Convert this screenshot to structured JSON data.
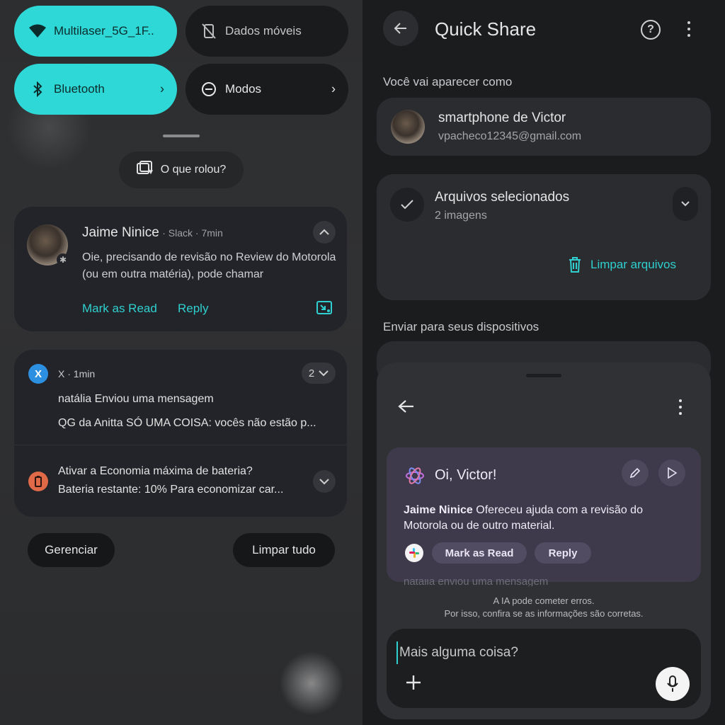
{
  "left": {
    "tiles": {
      "wifi": "Multilaser_5G_1F..",
      "mobile_data": "Dados móveis",
      "bluetooth": "Bluetooth",
      "modes": "Modos"
    },
    "what_chip": "O que rolou?",
    "slack_notification": {
      "sender": "Jaime Ninice",
      "meta": "· Slack · 7min",
      "body": "Oie, precisando de revisão no Review do Motorola (ou em outra matéria), pode chamar",
      "action_mark_read": "Mark as Read",
      "action_reply": "Reply"
    },
    "x_notification": {
      "meta": "X · 1min",
      "count": "2",
      "title": "natália Enviou uma mensagem",
      "body": "QG da Anitta SÓ UMA COISA: vocês não estão p..."
    },
    "battery_notification": {
      "title": "Ativar a Economia máxima de bateria?",
      "body": "Bateria restante: 10% Para economizar car..."
    },
    "manage_button": "Gerenciar",
    "clear_all_button": "Limpar tudo"
  },
  "right": {
    "title": "Quick Share",
    "visible_as_label": "Você vai aparecer como",
    "device_name": "smartphone de Victor",
    "email": "vpacheco12345@gmail.com",
    "files_title": "Arquivos selecionados",
    "files_count": "2 imagens",
    "clear_files": "Limpar arquivos",
    "send_label": "Enviar para seus dispositivos",
    "assistant": {
      "greeting": "Oi, Victor!",
      "summary_name": "Jaime Ninice",
      "summary_text": " Ofereceu ajuda com a revisão do Motorola ou de outro material.",
      "mark_read": "Mark as Read",
      "reply": "Reply",
      "faded_line": "natália enviou uma mensagem",
      "disclaimer_1": "A IA pode cometer erros.",
      "disclaimer_2": "Por isso, confira se as informações são corretas.",
      "input_placeholder": "Mais alguma coisa?"
    }
  },
  "colors": {
    "accent_teal": "#2ed8d6",
    "action_teal": "#2fd0cf",
    "assistant_purple": "#3e3a4b"
  }
}
